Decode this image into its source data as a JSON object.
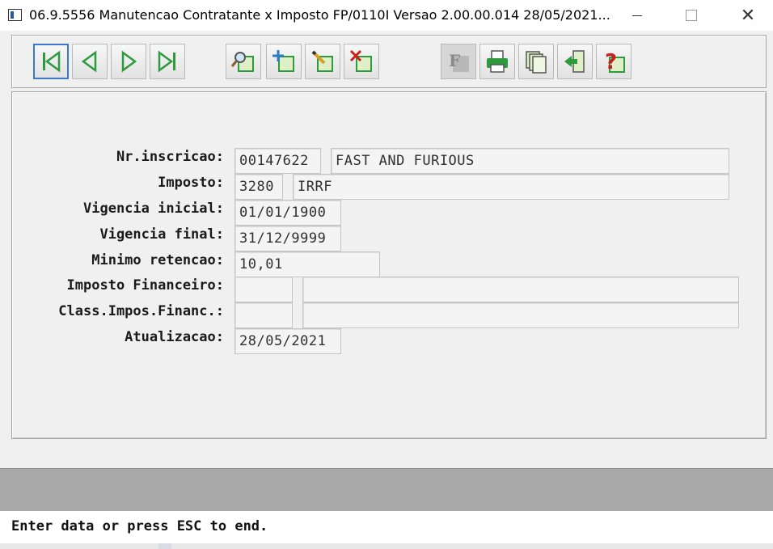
{
  "window": {
    "title": "06.9.5556 Manutencao  Contratante x Imposto FP/0110I Versao 2.00.00.014 28/05/2021...",
    "close_glyph": "✕"
  },
  "toolbar": {
    "buttons": [
      {
        "name": "first-record-icon",
        "tooltip": "first"
      },
      {
        "name": "previous-record-icon",
        "tooltip": "previous"
      },
      {
        "name": "next-record-icon",
        "tooltip": "next"
      },
      {
        "name": "last-record-icon",
        "tooltip": "last"
      },
      {
        "name": "search-icon",
        "tooltip": "search"
      },
      {
        "name": "add-icon",
        "tooltip": "add"
      },
      {
        "name": "edit-icon",
        "tooltip": "edit"
      },
      {
        "name": "delete-icon",
        "tooltip": "delete"
      },
      {
        "name": "filter-icon",
        "tooltip": "filter",
        "glyph": "F"
      },
      {
        "name": "print-icon",
        "tooltip": "print"
      },
      {
        "name": "copy-icon",
        "tooltip": "copy"
      },
      {
        "name": "exit-icon",
        "tooltip": "exit"
      },
      {
        "name": "help-icon",
        "tooltip": "help",
        "glyph": "?"
      }
    ]
  },
  "form": {
    "nr_inscricao": {
      "label": "Nr.inscricao:",
      "code": "00147622",
      "name": "FAST AND FURIOUS"
    },
    "imposto": {
      "label": "Imposto:",
      "code": "3280",
      "description": "IRRF"
    },
    "vigencia_inicial": {
      "label": "Vigencia inicial:",
      "value": "01/01/1900"
    },
    "vigencia_final": {
      "label": "Vigencia final:",
      "value": "31/12/9999"
    },
    "minimo_retencao": {
      "label": "Minimo retencao:",
      "value": "10,01"
    },
    "imposto_financeiro": {
      "label": "Imposto Financeiro:",
      "code": "",
      "description": ""
    },
    "class_impos_financ": {
      "label": "Class.Impos.Financ.:",
      "code": "",
      "description": ""
    },
    "atualizacao": {
      "label": "Atualizacao:",
      "value": "28/05/2021"
    }
  },
  "status": {
    "message": "Enter data or press ESC to end."
  },
  "colors": {
    "accent": "#3a78c9",
    "icon_green": "#2e9a3e",
    "icon_red": "#c8201e",
    "icon_blue": "#2f78c8"
  }
}
